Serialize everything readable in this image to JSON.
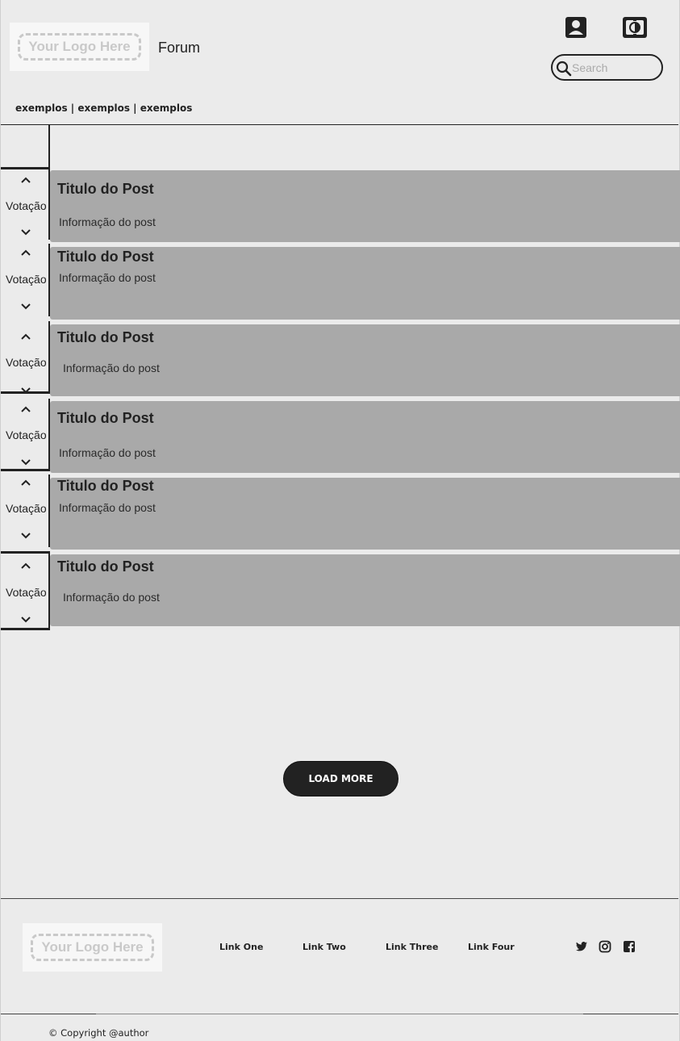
{
  "header": {
    "logo_text": "Your Logo Here",
    "title": "Forum",
    "profile_icon": "account-box-icon",
    "theme_icon": "brightness-contrast-icon",
    "search": {
      "placeholder": "Search",
      "value": ""
    },
    "nav": [
      "exemplos",
      "exemplos",
      "exemplos"
    ],
    "nav_separator": " | "
  },
  "posts": [
    {
      "vote_label": "Votação",
      "title": "Titulo do Post",
      "info": "Informação do post"
    },
    {
      "vote_label": "Votação",
      "title": "Titulo do Post",
      "info": "Informação do post"
    },
    {
      "vote_label": "Votação",
      "title": "Titulo do Post",
      "info": "Informação do post"
    },
    {
      "vote_label": "Votação",
      "title": "Titulo do Post",
      "info": "Informação do post"
    },
    {
      "vote_label": "Votação",
      "title": "Titulo do Post",
      "info": "Informação do post"
    },
    {
      "vote_label": "Votação",
      "title": "Titulo do Post",
      "info": "Informação do post"
    }
  ],
  "load_more_label": "LOAD MORE",
  "footer": {
    "logo_text": "Your Logo Here",
    "links": [
      "Link One",
      "Link Two",
      "Link Three",
      "Link Four"
    ],
    "social_icons": [
      "twitter-icon",
      "instagram-icon",
      "facebook-icon"
    ],
    "copyright": "© Copyright @author"
  },
  "colors": {
    "background": "#ebebeb",
    "post_card": "#a9a9a9",
    "dark": "#222222",
    "logo_placeholder": "#c9c9c9"
  }
}
